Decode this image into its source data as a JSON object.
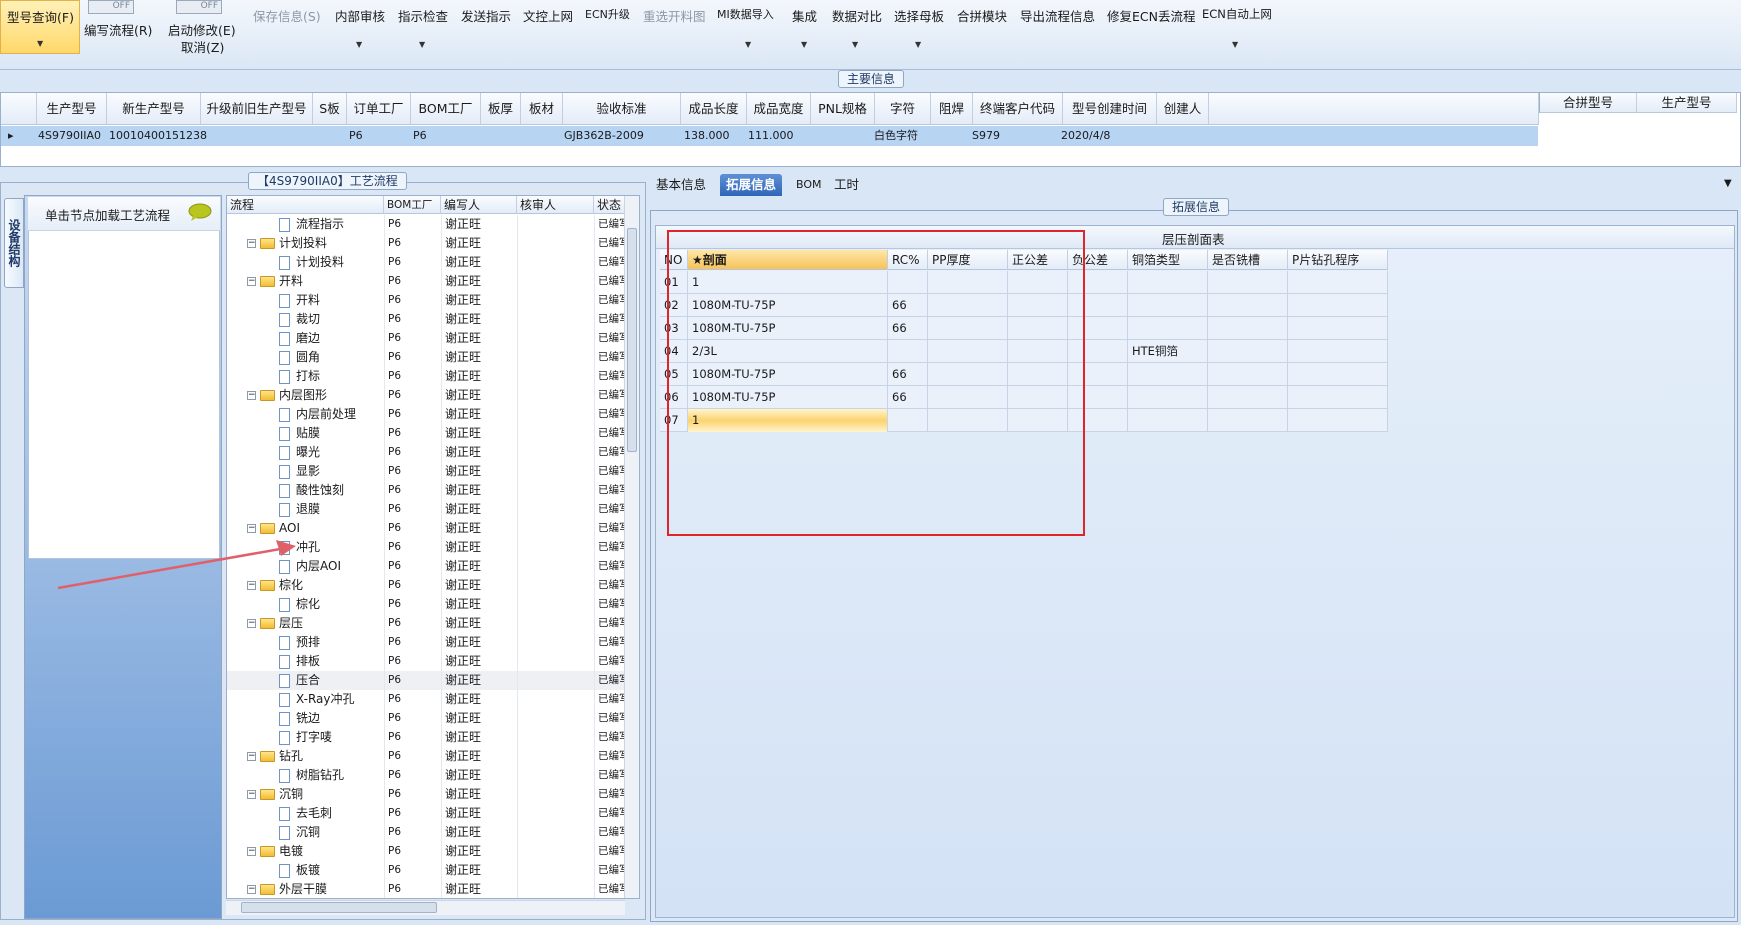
{
  "ribbon": {
    "query": "型号查询(F)",
    "write_flow": "编写流程(R)",
    "start_modify": "启动修改(E)",
    "cancel": "取消(Z)",
    "toggle_off": "OFF",
    "save": "保存信息(S)",
    "internal_review": "内部审核",
    "directive_check": "指示检查",
    "send_directive": "发送指示",
    "doc_upload": "文控上网",
    "ecn_upgrade": "ECN升级",
    "reselect_map": "重选开料图",
    "mi_import": "MI数据导入",
    "integrate": "集成",
    "data_compare": "数据对比",
    "select_mother": "选择母板",
    "merge_module": "合拼模块",
    "export_flow": "导出流程信息",
    "fix_ecn": "修复ECN丢流程",
    "ecn_auto": "ECN自动上网"
  },
  "main_info": {
    "title": "主要信息",
    "columns": [
      "生产型号",
      "新生产型号",
      "升级前旧生产型号",
      "S板",
      "订单工厂",
      "BOM工厂",
      "板厚",
      "板材",
      "验收标准",
      "成品长度",
      "成品宽度",
      "PNL规格",
      "字符",
      "阻焊",
      "终端客户代码",
      "型号创建时间",
      "创建人"
    ],
    "row": {
      "model": "4S9790IIA0",
      "new_model": "10010400151238",
      "order_factory": "P6",
      "bom_factory": "P6",
      "standard": "GJB362B-2009",
      "length": "138.000",
      "width": "111.000",
      "char": "白色字符",
      "customer": "S979",
      "created": "2020/4/8"
    },
    "merge_cols": [
      "合拼型号",
      "生产型号"
    ]
  },
  "left": {
    "title": "【4S9790IIA0】工艺流程",
    "side_tab": "设备结构",
    "hint": "单击节点加载工艺流程",
    "columns": [
      "流程",
      "BOM工厂",
      "编写人",
      "核审人",
      "状态"
    ],
    "rows": [
      {
        "name": "流程指示",
        "type": "doc",
        "bom": "P6",
        "writer": "谢正旺",
        "status": "已编写"
      },
      {
        "name": "计划投料",
        "type": "folder",
        "bom": "P6",
        "writer": "谢正旺",
        "status": "已编写"
      },
      {
        "name": "计划投料",
        "type": "doc",
        "bom": "P6",
        "writer": "谢正旺",
        "status": "已编写"
      },
      {
        "name": "开料",
        "type": "folder",
        "bom": "P6",
        "writer": "谢正旺",
        "status": "已编写"
      },
      {
        "name": "开料",
        "type": "doc",
        "bom": "P6",
        "writer": "谢正旺",
        "status": "已编写"
      },
      {
        "name": "裁切",
        "type": "doc",
        "bom": "P6",
        "writer": "谢正旺",
        "status": "已编写"
      },
      {
        "name": "磨边",
        "type": "doc",
        "bom": "P6",
        "writer": "谢正旺",
        "status": "已编写"
      },
      {
        "name": "圆角",
        "type": "doc",
        "bom": "P6",
        "writer": "谢正旺",
        "status": "已编写"
      },
      {
        "name": "打标",
        "type": "doc",
        "bom": "P6",
        "writer": "谢正旺",
        "status": "已编写"
      },
      {
        "name": "内层图形",
        "type": "folder",
        "bom": "P6",
        "writer": "谢正旺",
        "status": "已编写"
      },
      {
        "name": "内层前处理",
        "type": "doc",
        "bom": "P6",
        "writer": "谢正旺",
        "status": "已编写"
      },
      {
        "name": "贴膜",
        "type": "doc",
        "bom": "P6",
        "writer": "谢正旺",
        "status": "已编写"
      },
      {
        "name": "曝光",
        "type": "doc",
        "bom": "P6",
        "writer": "谢正旺",
        "status": "已编写"
      },
      {
        "name": "显影",
        "type": "doc",
        "bom": "P6",
        "writer": "谢正旺",
        "status": "已编写"
      },
      {
        "name": "酸性蚀刻",
        "type": "doc",
        "bom": "P6",
        "writer": "谢正旺",
        "status": "已编写"
      },
      {
        "name": "退膜",
        "type": "doc",
        "bom": "P6",
        "writer": "谢正旺",
        "status": "已编写"
      },
      {
        "name": "AOI",
        "type": "folder",
        "bom": "P6",
        "writer": "谢正旺",
        "status": "已编写"
      },
      {
        "name": "冲孔",
        "type": "doc",
        "bom": "P6",
        "writer": "谢正旺",
        "status": "已编写"
      },
      {
        "name": "内层AOI",
        "type": "doc",
        "bom": "P6",
        "writer": "谢正旺",
        "status": "已编写"
      },
      {
        "name": "棕化",
        "type": "folder",
        "bom": "P6",
        "writer": "谢正旺",
        "status": "已编写"
      },
      {
        "name": "棕化",
        "type": "doc",
        "bom": "P6",
        "writer": "谢正旺",
        "status": "已编写"
      },
      {
        "name": "层压",
        "type": "folder",
        "bom": "P6",
        "writer": "谢正旺",
        "status": "已编写"
      },
      {
        "name": "预排",
        "type": "doc",
        "bom": "P6",
        "writer": "谢正旺",
        "status": "已编写"
      },
      {
        "name": "排板",
        "type": "doc",
        "bom": "P6",
        "writer": "谢正旺",
        "status": "已编写"
      },
      {
        "name": "压合",
        "type": "doc",
        "bom": "P6",
        "writer": "谢正旺",
        "status": "已编写"
      },
      {
        "name": "X-Ray冲孔",
        "type": "doc",
        "bom": "P6",
        "writer": "谢正旺",
        "status": "已编写"
      },
      {
        "name": "铣边",
        "type": "doc",
        "bom": "P6",
        "writer": "谢正旺",
        "status": "已编写"
      },
      {
        "name": "打字唛",
        "type": "doc",
        "bom": "P6",
        "writer": "谢正旺",
        "status": "已编写"
      },
      {
        "name": "钻孔",
        "type": "folder",
        "bom": "P6",
        "writer": "谢正旺",
        "status": "已编写"
      },
      {
        "name": "树脂钻孔",
        "type": "doc",
        "bom": "P6",
        "writer": "谢正旺",
        "status": "已编写"
      },
      {
        "name": "沉铜",
        "type": "folder",
        "bom": "P6",
        "writer": "谢正旺",
        "status": "已编写"
      },
      {
        "name": "去毛刺",
        "type": "doc",
        "bom": "P6",
        "writer": "谢正旺",
        "status": "已编写"
      },
      {
        "name": "沉铜",
        "type": "doc",
        "bom": "P6",
        "writer": "谢正旺",
        "status": "已编写"
      },
      {
        "name": "电镀",
        "type": "folder",
        "bom": "P6",
        "writer": "谢正旺",
        "status": "已编写"
      },
      {
        "name": "板镀",
        "type": "doc",
        "bom": "P6",
        "writer": "谢正旺",
        "status": "已编写"
      },
      {
        "name": "外层干膜",
        "type": "folder",
        "bom": "P6",
        "writer": "谢正旺",
        "status": "已编写"
      }
    ]
  },
  "right": {
    "tabs": [
      "基本信息",
      "拓展信息",
      "BOM",
      "工时"
    ],
    "section_title": "拓展信息",
    "press_title": "层压剖面表",
    "columns": [
      "NO",
      "★剖面",
      "RC%",
      "PP厚度",
      "正公差",
      "负公差",
      "铜箔类型",
      "是否铣槽",
      "P片钻孔程序"
    ],
    "rows": [
      {
        "no": "01",
        "section": "1",
        "rc": "",
        "foil": ""
      },
      {
        "no": "02",
        "section": "1080M-TU-75P",
        "rc": "66",
        "foil": ""
      },
      {
        "no": "03",
        "section": "1080M-TU-75P",
        "rc": "66",
        "foil": ""
      },
      {
        "no": "04",
        "section": "2/3L",
        "rc": "",
        "foil": "HTE铜箔"
      },
      {
        "no": "05",
        "section": "1080M-TU-75P",
        "rc": "66",
        "foil": ""
      },
      {
        "no": "06",
        "section": "1080M-TU-75P",
        "rc": "66",
        "foil": ""
      },
      {
        "no": "07",
        "section": "1",
        "rc": "",
        "foil": ""
      }
    ]
  },
  "colors": {
    "highlight": "#e0242b",
    "selection": "#b7d4f3",
    "accent": "#2f66b8"
  }
}
